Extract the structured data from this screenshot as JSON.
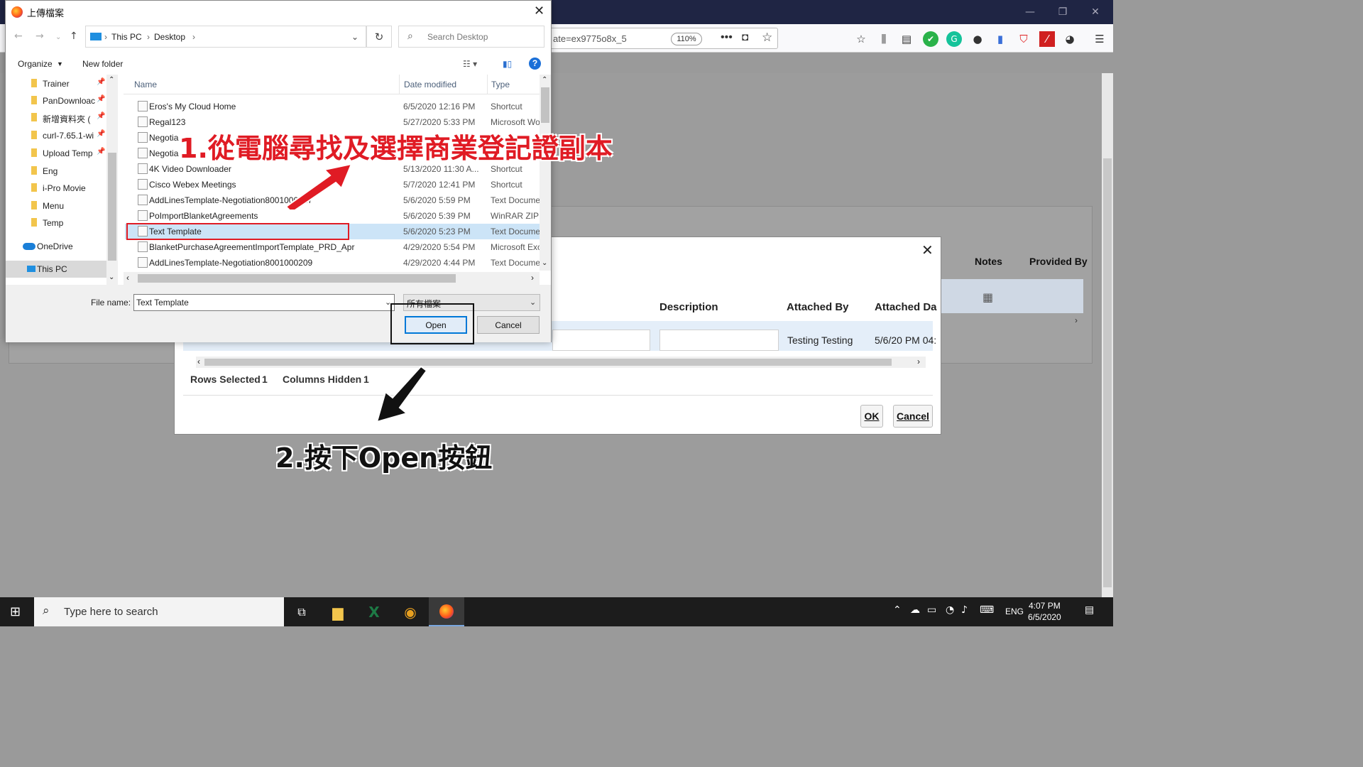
{
  "browser": {
    "url_fragment": "ate=ex9775o8x_5",
    "zoom": "110%"
  },
  "file_dialog": {
    "title": "上傳檔案",
    "breadcrumb": [
      "This PC",
      "Desktop"
    ],
    "search_placeholder": "Search Desktop",
    "organize": "Organize",
    "new_folder": "New folder",
    "nav_items": [
      "Trainer",
      "PanDownloac",
      "新增資料夾 (",
      "curl-7.65.1-wi",
      "Upload Temp",
      "Eng",
      "i-Pro Movie",
      "Menu",
      "Temp",
      "OneDrive",
      "This PC"
    ],
    "columns": [
      "Name",
      "Date modified",
      "Type"
    ],
    "files": [
      {
        "name": "Eros's My Cloud Home",
        "date": "6/5/2020 12:16 PM",
        "type": "Shortcut"
      },
      {
        "name": "Regal123",
        "date": "5/27/2020 5:33 PM",
        "type": "Microsoft Wo"
      },
      {
        "name": "Negotia",
        "date": "",
        "type": ""
      },
      {
        "name": "Negotia",
        "date": "",
        "type": ""
      },
      {
        "name": "4K Video Downloader",
        "date": "5/13/2020 11:30 A...",
        "type": "Shortcut"
      },
      {
        "name": "Cisco Webex Meetings",
        "date": "5/7/2020 12:41 PM",
        "type": "Shortcut"
      },
      {
        "name": "AddLinesTemplate-Negotiation8001000227",
        "date": "5/6/2020 5:59 PM",
        "type": "Text Docume"
      },
      {
        "name": "PoImportBlanketAgreements",
        "date": "5/6/2020 5:39 PM",
        "type": "WinRAR ZIP"
      },
      {
        "name": "Text Template",
        "date": "5/6/2020 5:23 PM",
        "type": "Text Docume"
      },
      {
        "name": "BlanketPurchaseAgreementImportTemplate_PRD_Apr",
        "date": "4/29/2020 5:54 PM",
        "type": "Microsoft Exc"
      },
      {
        "name": "AddLinesTemplate-Negotiation8001000209",
        "date": "4/29/2020 4:44 PM",
        "type": "Text Docume"
      }
    ],
    "file_name_label": "File name:",
    "file_name_value": "Text Template",
    "filter_value": "所有檔案",
    "open_label": "Open",
    "cancel_label": "Cancel"
  },
  "attach_dialog": {
    "headers": [
      "Description",
      "Attached By",
      "Attached Da"
    ],
    "row": {
      "attached_by": "Testing Testing",
      "attached_date": "5/6/20 PM 04:"
    },
    "rows_selected_label": "Rows Selected",
    "rows_selected_value": "1",
    "columns_hidden_label": "Columns Hidden",
    "columns_hidden_value": "1",
    "ok_label": "OK",
    "cancel_label": "Cancel"
  },
  "bg_headers": [
    "Notes",
    "Provided By"
  ],
  "annotations": {
    "step1": "1.從電腦尋找及選擇商業登記證副本",
    "step2": "2.按下Open按鈕"
  },
  "taskbar": {
    "search_placeholder": "Type here to search",
    "lang": "ENG",
    "time": "4:07 PM",
    "date": "6/5/2020"
  },
  "colors": {
    "annotation_red": "#e01b24",
    "highlight_blue": "#cce4f7",
    "titlebar": "#1f2544"
  }
}
